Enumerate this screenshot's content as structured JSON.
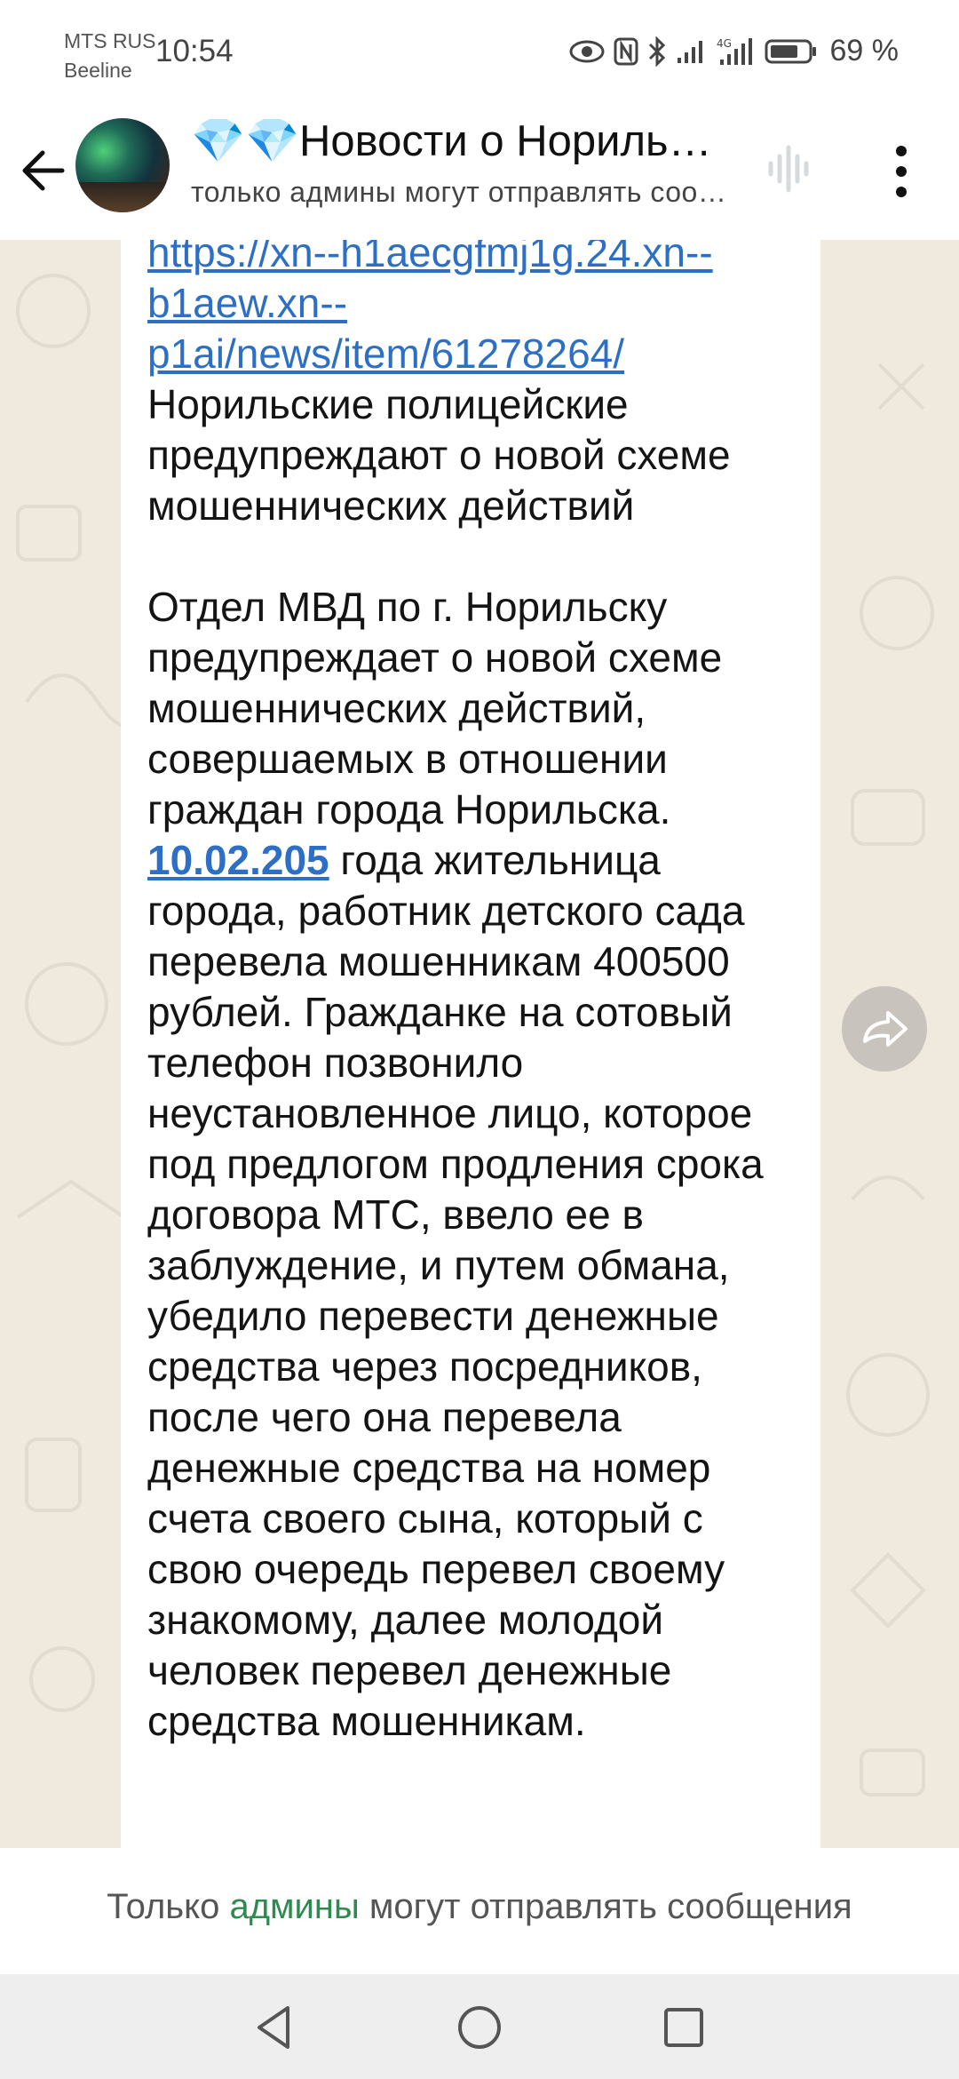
{
  "status_bar": {
    "carrier1": "MTS RUS",
    "carrier2": "Beeline",
    "time": "10:54",
    "battery": "69 %",
    "icons": [
      "eye-icon",
      "nfc-icon",
      "bluetooth-icon",
      "signal-icon",
      "signal-4g-icon",
      "battery-icon"
    ]
  },
  "header": {
    "title": "💎💎Новости о Норильске",
    "subtitle": "только админы могут отправлять сообщения",
    "back_icon": "arrow-left-icon",
    "voice_icon": "voice-chat-icon",
    "menu_icon": "more-vertical-icon"
  },
  "message": {
    "link": "https://xn--h1aecgfmj1g.24.xn--b1aew.xn--p1ai/news/item/61278264/",
    "headline": "Норильские полицейские предупреждают о новой схеме мошеннических действий",
    "para1": "Отдел МВД по г. Норильску предупреждает о новой схеме мошеннических действий, совершаемых в отношении граждан города Норильска.",
    "date": "10.02.205",
    "para2": " года жительница города, работник детского сада перевела мошенникам 400500 рублей. Гражданке на сотовый телефон позвонило неустановленное лицо, которое под предлогом продления срока договора МТС, ввело ее в заблуждение, и путем обмана, убедило перевести денежные средства через посредников, после чего она перевела денежные средства на номер счета своего сына, который с свою очередь перевел своему знакомому, далее молодой человек перевел денежные средства мошенникам."
  },
  "forward_icon": "forward-arrow-icon",
  "footer": {
    "prefix": "Только ",
    "admins": "админы",
    "suffix": " могут отправлять сообщения"
  },
  "navbar": {
    "back": "nav-back-icon",
    "home": "nav-home-icon",
    "recents": "nav-recents-icon"
  },
  "colors": {
    "chat_bg": "#efe9de",
    "link": "#2c6fc5",
    "admins_accent": "#2e8a4e"
  }
}
